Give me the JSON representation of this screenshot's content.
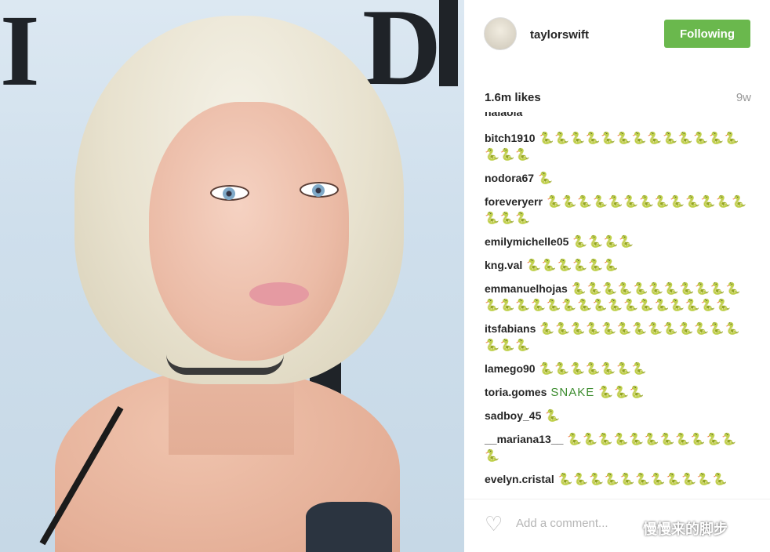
{
  "post": {
    "username": "taylorswift",
    "follow_label": "Following",
    "likes": "1.6m likes",
    "age": "9w",
    "cut_name": "nalaola"
  },
  "comments": [
    {
      "user": "bitch1910",
      "text": "🐍🐍🐍🐍🐍🐍🐍🐍🐍🐍🐍🐍🐍🐍🐍🐍"
    },
    {
      "user": "nodora67",
      "text": "🐍"
    },
    {
      "user": "foreveryerr",
      "text": "🐍🐍🐍🐍🐍🐍🐍🐍🐍🐍🐍🐍🐍🐍🐍🐍"
    },
    {
      "user": "emilymichelle05",
      "text": "🐍🐍🐍🐍"
    },
    {
      "user": "kng.val",
      "text": "🐍🐍🐍🐍🐍🐍"
    },
    {
      "user": "emmanuelhojas",
      "text": "🐍🐍🐍🐍🐍🐍🐍🐍🐍🐍🐍🐍🐍🐍🐍🐍🐍🐍🐍🐍🐍🐍🐍🐍🐍🐍🐍"
    },
    {
      "user": "itsfabians",
      "text": "🐍🐍🐍🐍🐍🐍🐍🐍🐍🐍🐍🐍🐍🐍🐍🐍"
    },
    {
      "user": "lamego90",
      "text": "🐍🐍🐍🐍🐍🐍🐍"
    },
    {
      "user": "toria.gomes",
      "text": "SNAKE 🐍🐍🐍"
    },
    {
      "user": "sadboy_45",
      "text": "🐍"
    },
    {
      "user": "__mariana13__",
      "text": "🐍🐍🐍🐍🐍🐍🐍🐍🐍🐍🐍🐍"
    },
    {
      "user": "evelyn.cristal",
      "text": "🐍🐍🐍🐍🐍🐍🐍🐍🐍🐍🐍"
    }
  ],
  "footer": {
    "add_comment_placeholder": "Add a comment...",
    "watermark": "慢慢来的脚步"
  },
  "icons": {
    "heart": "heart-icon",
    "avatar": "avatar"
  },
  "colors": {
    "follow_button": "#6ab84d",
    "snake": "#3c8c2e"
  }
}
